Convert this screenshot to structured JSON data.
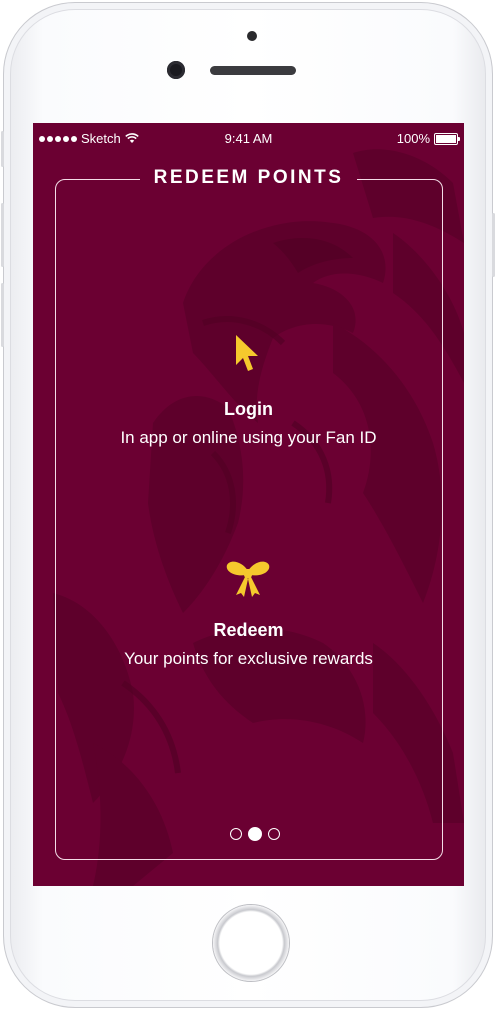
{
  "status_bar": {
    "carrier": "Sketch",
    "time": "9:41 AM",
    "battery": "100%"
  },
  "screen": {
    "title": "REDEEM POINTS",
    "steps": [
      {
        "icon": "cursor-icon",
        "title": "Login",
        "description": "In app or online using your Fan ID"
      },
      {
        "icon": "bow-icon",
        "title": "Redeem",
        "description": "Your points for exclusive rewards"
      }
    ],
    "pager": {
      "count": 3,
      "active_index": 1
    }
  },
  "colors": {
    "background": "#6b0032",
    "accent": "#f5c92d",
    "text": "#ffffff"
  }
}
